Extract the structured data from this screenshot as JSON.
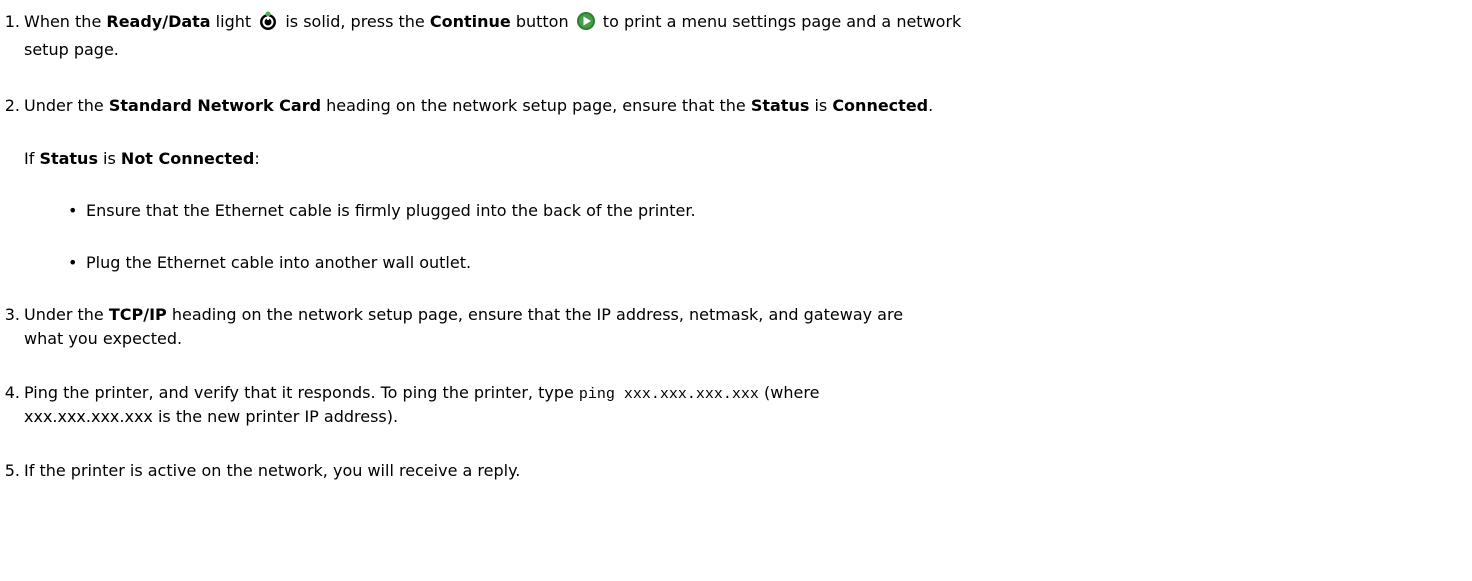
{
  "steps": [
    {
      "number": "1.",
      "t1": "When the ",
      "b1": "Ready/Data",
      "t2": " light ",
      "t3": " is solid, press the ",
      "b2": "Continue",
      "t4": " button ",
      "t5": " to print a menu settings page and a network",
      "line2": "setup page.",
      "icons": {
        "ready_data_light": "power-light-icon",
        "continue_button": "continue-play-icon"
      },
      "colors": {
        "ready_icon": "#000000",
        "ready_icon_glow": "#4caf50",
        "continue_icon": "#2e7d32",
        "continue_icon_arrow": "#ffffff"
      }
    },
    {
      "number": "2.",
      "t1": "Under the ",
      "b1": "Standard Network Card",
      "t2": " heading on the network setup page, ensure that the ",
      "b2": "Status",
      "t3": " is ",
      "b3": "Connected",
      "t4": ".",
      "sub_t1": "If ",
      "sub_b1": "Status",
      "sub_t2": " is ",
      "sub_b2": "Not Connected",
      "sub_t3": ":",
      "bullets": [
        "Ensure that the Ethernet cable is firmly plugged into the back of the printer.",
        "Plug the Ethernet cable into another wall outlet."
      ]
    },
    {
      "number": "3.",
      "t1": "Under the ",
      "b1": "TCP/IP",
      "t2": " heading on the network setup page, ensure that the IP address, netmask, and gateway are",
      "line2": "what you expected."
    },
    {
      "number": "4.",
      "t1": "Ping the printer, and verify that it responds. To ping the printer, type ",
      "code": "ping xxx.xxx.xxx.xxx",
      "t2": " (where",
      "line2": "xxx.xxx.xxx.xxx is the new printer IP address)."
    },
    {
      "number": "5.",
      "t1": "If the printer is active on the network, you will receive a reply."
    }
  ]
}
